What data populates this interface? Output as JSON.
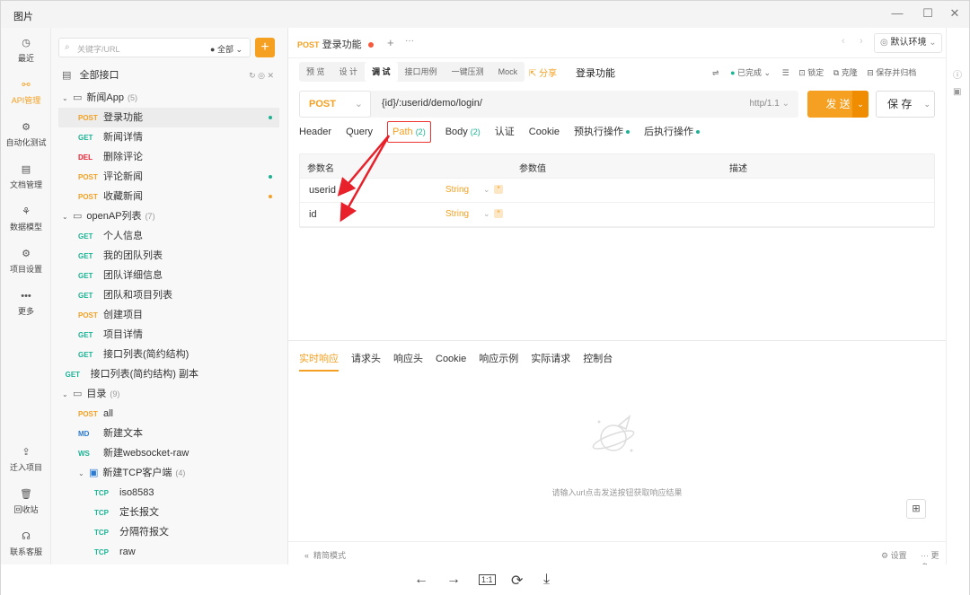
{
  "window": {
    "title": "图片"
  },
  "rail": [
    {
      "label": "最近",
      "icon": "clock-icon",
      "glyph": "◷",
      "active": false
    },
    {
      "label": "API管理",
      "icon": "api-icon",
      "glyph": "⚯",
      "active": true
    },
    {
      "label": "自动化测试",
      "icon": "automation-icon",
      "glyph": "⚙",
      "active": false
    },
    {
      "label": "文档管理",
      "icon": "document-icon",
      "glyph": "▤",
      "active": false
    },
    {
      "label": "数据模型",
      "icon": "model-icon",
      "glyph": "⚘",
      "active": false
    },
    {
      "label": "项目设置",
      "icon": "settings-icon",
      "glyph": "⚙",
      "active": false
    },
    {
      "label": "更多",
      "icon": "more-icon",
      "glyph": "•••",
      "active": false
    }
  ],
  "rail_bottom": [
    {
      "label": "迁入项目",
      "icon": "import-icon",
      "glyph": "⇪"
    },
    {
      "label": "回收站",
      "icon": "trash-icon",
      "glyph": "🗑"
    },
    {
      "label": "联系客服",
      "icon": "headset-icon",
      "glyph": "☊"
    }
  ],
  "search": {
    "placeholder": "关键字/URL",
    "scope": "全部"
  },
  "tree_header": "全部接口",
  "tree": [
    {
      "type": "folder",
      "label": "新闻App",
      "count": "(5)",
      "depth": 0
    },
    {
      "type": "api",
      "method": "POST",
      "label": "登录功能",
      "depth": 1,
      "selected": true,
      "dot": "#1ab394"
    },
    {
      "type": "api",
      "method": "GET",
      "label": "新闻详情",
      "depth": 1
    },
    {
      "type": "api",
      "method": "DEL",
      "label": "删除评论",
      "depth": 1
    },
    {
      "type": "api",
      "method": "POST",
      "label": "评论新闻",
      "depth": 1,
      "dot": "#1ab394"
    },
    {
      "type": "api",
      "method": "POST",
      "label": "收藏新闻",
      "depth": 1,
      "dot": "#f5a020"
    },
    {
      "type": "folder",
      "label": "openAP列表",
      "count": "(7)",
      "depth": 0
    },
    {
      "type": "api",
      "method": "GET",
      "label": "个人信息",
      "depth": 1
    },
    {
      "type": "api",
      "method": "GET",
      "label": "我的团队列表",
      "depth": 1
    },
    {
      "type": "api",
      "method": "GET",
      "label": "团队详细信息",
      "depth": 1
    },
    {
      "type": "api",
      "method": "GET",
      "label": "团队和项目列表",
      "depth": 1
    },
    {
      "type": "api",
      "method": "POST",
      "label": "创建项目",
      "depth": 1
    },
    {
      "type": "api",
      "method": "GET",
      "label": "项目详情",
      "depth": 1
    },
    {
      "type": "api",
      "method": "GET",
      "label": "接口列表(简约结构)",
      "depth": 1
    },
    {
      "type": "api",
      "method": "GET",
      "label": "接口列表(简约结构) 副本",
      "depth": 0.2
    },
    {
      "type": "folder",
      "label": "目录",
      "count": "(9)",
      "depth": 0
    },
    {
      "type": "api",
      "method": "POST",
      "label": "all",
      "depth": 1
    },
    {
      "type": "api",
      "method": "MD",
      "label": "新建文本",
      "depth": 1
    },
    {
      "type": "api",
      "method": "WS",
      "label": "新建websocket-raw",
      "depth": 1
    },
    {
      "type": "tcpfolder",
      "label": "新建TCP客户端",
      "count": "(4)",
      "depth": 1
    },
    {
      "type": "api",
      "method": "TCP",
      "label": "iso8583",
      "depth": 2
    },
    {
      "type": "api",
      "method": "TCP",
      "label": "定长报文",
      "depth": 2
    },
    {
      "type": "api",
      "method": "TCP",
      "label": "分隔符报文",
      "depth": 2
    },
    {
      "type": "api",
      "method": "TCP",
      "label": "raw",
      "depth": 2
    }
  ],
  "doc_tab": {
    "method": "POST",
    "label": "登录功能"
  },
  "env": "默认环境",
  "subtabs": [
    "预 览",
    "设 计",
    "调 试",
    "接口用例",
    "一键压测",
    "Mock"
  ],
  "subtab_active": 2,
  "share_label": "分享",
  "api_name": "登录功能",
  "status_label": "已完成",
  "actions": [
    "锁定",
    "克隆",
    "保存并归档"
  ],
  "request": {
    "method": "POST",
    "url": "{id}/:userid/demo/login/",
    "protocol": "http/1.1"
  },
  "send_label": "发 送",
  "save_label": "保 存",
  "req_tabs": [
    {
      "label": "Header",
      "count": ""
    },
    {
      "label": "Query",
      "count": ""
    },
    {
      "label": "Path",
      "count": "(2)",
      "active": true
    },
    {
      "label": "Body",
      "count": "(2)"
    },
    {
      "label": "认证",
      "count": ""
    },
    {
      "label": "Cookie",
      "count": ""
    },
    {
      "label": "预执行操作",
      "count": "",
      "dot": true
    },
    {
      "label": "后执行操作",
      "count": "",
      "dot": true
    }
  ],
  "param_headers": [
    "参数名",
    "参数值",
    "描述"
  ],
  "params": [
    {
      "name": "userid",
      "type": "String"
    },
    {
      "name": "id",
      "type": "String"
    }
  ],
  "resp_tabs": [
    "实时响应",
    "请求头",
    "响应头",
    "Cookie",
    "响应示例",
    "实际请求",
    "控制台"
  ],
  "resp_empty": "请输入url点击发送按钮获取响应结果",
  "statusbar": {
    "left": "精简模式",
    "settings": "设置",
    "more": "更多"
  }
}
